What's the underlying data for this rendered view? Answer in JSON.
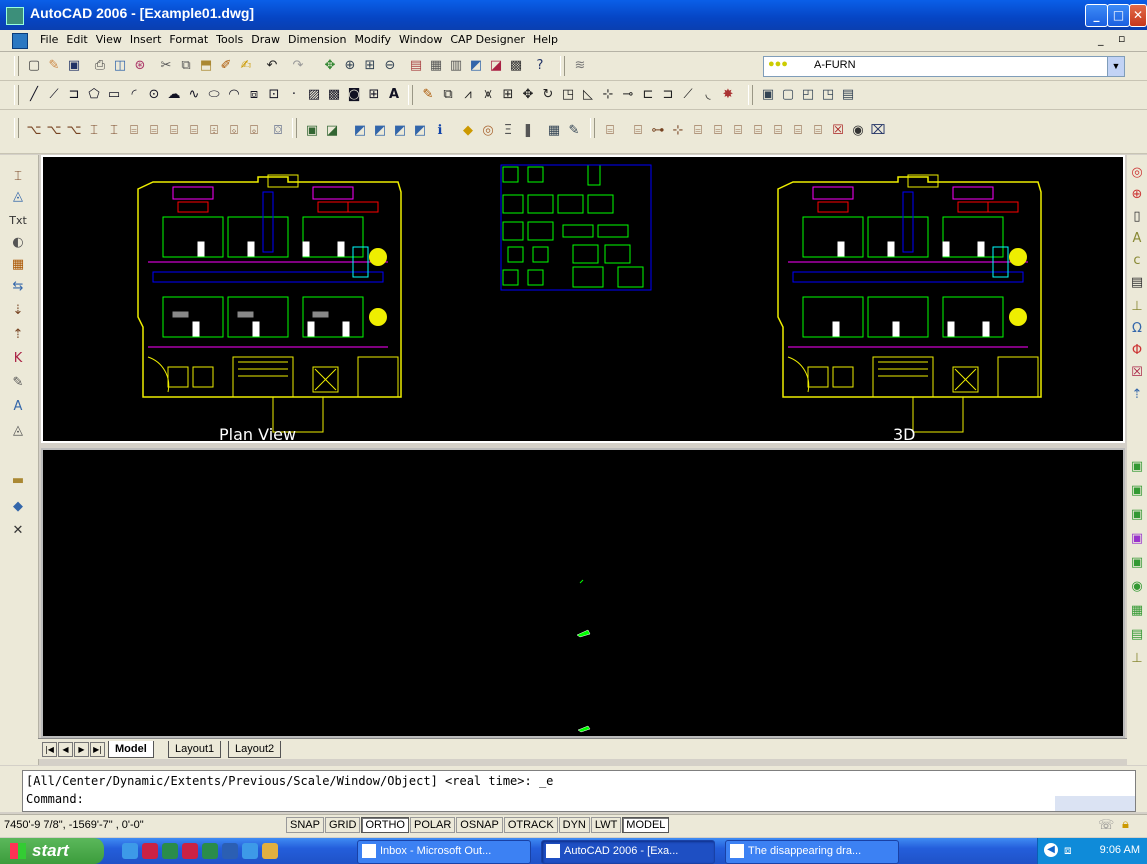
{
  "window": {
    "title": "AutoCAD 2006 - [Example01.dwg]"
  },
  "menu": [
    "File",
    "Edit",
    "View",
    "Insert",
    "Format",
    "Tools",
    "Draw",
    "Dimension",
    "Modify",
    "Window",
    "CAP Designer",
    "Help"
  ],
  "toolbar": {
    "layer_name": "A-FURN"
  },
  "viewports": {
    "left_label": "Plan View",
    "right_label": "3D"
  },
  "tabs": {
    "model": "Model",
    "layout1": "Layout1",
    "layout2": "Layout2"
  },
  "command": {
    "history": "[All/Center/Dynamic/Extents/Previous/Scale/Window/Object] <real time>: _e",
    "prompt": "Command:"
  },
  "status": {
    "coords": "7450'-9 7/8\", -1569'-7\"  , 0'-0\"",
    "toggles": [
      {
        "label": "SNAP",
        "on": false
      },
      {
        "label": "GRID",
        "on": false
      },
      {
        "label": "ORTHO",
        "on": true
      },
      {
        "label": "POLAR",
        "on": false
      },
      {
        "label": "OSNAP",
        "on": false
      },
      {
        "label": "OTRACK",
        "on": false
      },
      {
        "label": "DYN",
        "on": false
      },
      {
        "label": "LWT",
        "on": false
      },
      {
        "label": "MODEL",
        "on": true
      }
    ]
  },
  "taskbar": {
    "start": "start",
    "tasks": [
      {
        "label": "Inbox - Microsoft Out...",
        "active": false
      },
      {
        "label": "AutoCAD 2006 - [Exa...",
        "active": true
      },
      {
        "label": "The disappearing dra...",
        "active": false
      }
    ],
    "clock": "9:06 AM"
  }
}
